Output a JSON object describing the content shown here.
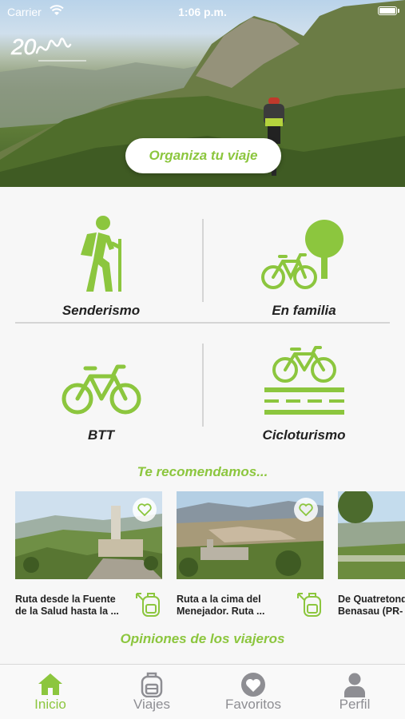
{
  "status_bar": {
    "carrier": "Carrier",
    "time": "1:06 p.m."
  },
  "hero": {
    "cta_label": "Organiza tu viaje"
  },
  "categories": [
    {
      "label": "Senderismo",
      "icon": "hiker-icon"
    },
    {
      "label": "En familia",
      "icon": "family-bike-tree-icon"
    },
    {
      "label": "BTT",
      "icon": "mountain-bike-icon"
    },
    {
      "label": "Cicloturismo",
      "icon": "road-bike-icon"
    }
  ],
  "recommended": {
    "title": "Te recomendamos...",
    "items": [
      {
        "title": "Ruta desde la Fuente\nde la Salud hasta la ..."
      },
      {
        "title": "Ruta a la cima del\nMenejador. Ruta ..."
      },
      {
        "title": "De Quatretonda\nBenasau (PR-"
      }
    ]
  },
  "opinions": {
    "title": "Opiniones de los viajeros"
  },
  "tabs": [
    {
      "label": "Inicio",
      "icon": "home-icon",
      "active": true
    },
    {
      "label": "Viajes",
      "icon": "backpack-icon",
      "active": false
    },
    {
      "label": "Favoritos",
      "icon": "heart-icon",
      "active": false
    },
    {
      "label": "Perfil",
      "icon": "person-icon",
      "active": false
    }
  ],
  "colors": {
    "accent": "#8cc63e",
    "inactive": "#8e8e93",
    "text": "#222222"
  }
}
